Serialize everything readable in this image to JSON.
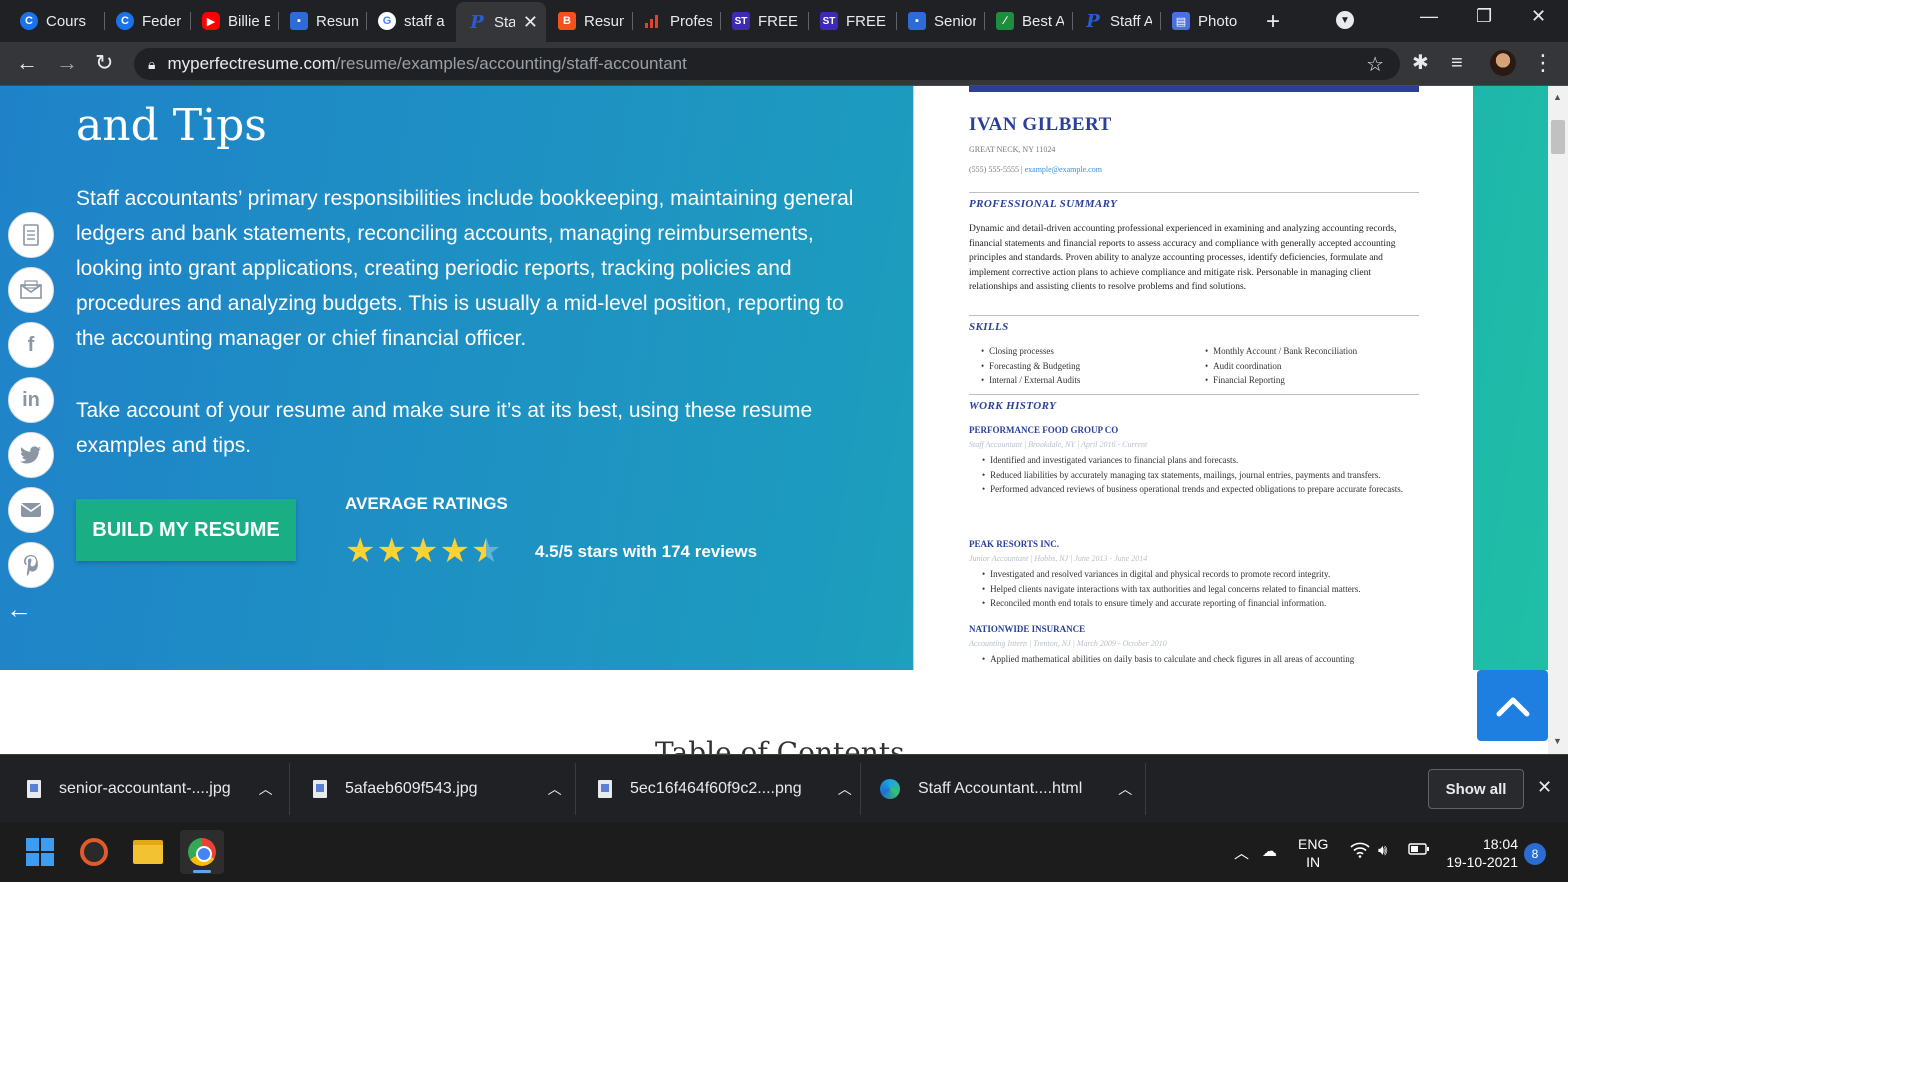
{
  "browser": {
    "tabs": [
      {
        "title": "Cours",
        "favicon": "c-blue-icon",
        "active": false
      },
      {
        "title": "Feder",
        "favicon": "c-blue-icon",
        "active": false
      },
      {
        "title": "Billie E",
        "favicon": "youtube-icon",
        "active": false
      },
      {
        "title": "Resum",
        "favicon": "document-icon",
        "active": false
      },
      {
        "title": "staff a",
        "favicon": "google-icon",
        "active": false
      },
      {
        "title": "Sta",
        "favicon": "p-logo-icon",
        "active": true
      },
      {
        "title": "Resum",
        "favicon": "blogger-icon",
        "active": false
      },
      {
        "title": "Profes",
        "favicon": "bars-icon",
        "active": false
      },
      {
        "title": "FREE",
        "favicon": "st-icon",
        "active": false
      },
      {
        "title": "FREE",
        "favicon": "st-icon",
        "active": false
      },
      {
        "title": "Senior",
        "favicon": "document-icon",
        "active": false
      },
      {
        "title": "Best A",
        "favicon": "chart-icon",
        "active": false
      },
      {
        "title": "Staff A",
        "favicon": "p-logo-icon",
        "active": false
      },
      {
        "title": "Photo",
        "favicon": "doc-blue-icon",
        "active": false
      }
    ],
    "url_host": "myperfectresume.com",
    "url_path": "/resume/examples/accounting/staff-accountant"
  },
  "hero": {
    "title": "and Tips",
    "paragraph_1": "Staff accountants’ primary responsibilities include bookkeeping, maintaining general ledgers and bank statements, reconciling accounts, managing reimbursements, looking into grant applications, creating periodic reports, tracking policies and procedures and analyzing budgets. This is usually a mid-level position, reporting to the accounting manager or chief financial officer.",
    "paragraph_2": "Take account of your resume and make sure it’s at its best, using these resume examples and tips.",
    "cta_label": "BUILD MY RESUME",
    "ratings_heading": "AVERAGE RATINGS",
    "rating_value": 4.5,
    "rating_text": "4.5/5 stars with 174 reviews"
  },
  "share_icons": [
    "resume-icon",
    "mail-envelope-icon",
    "facebook-icon",
    "linkedin-icon",
    "twitter-icon",
    "email-icon",
    "pinterest-icon"
  ],
  "resume": {
    "name": "IVAN GILBERT",
    "location": "GREAT NECK, NY 11024",
    "phone": "(555) 555-5555 | ",
    "email": "example@example.com",
    "summary_heading": "PROFESSIONAL SUMMARY",
    "summary": "Dynamic and detail-driven accounting professional experienced in examining and analyzing accounting records, financial statements and financial reports to assess accuracy and compliance with generally accepted accounting principles and standards. Proven ability to analyze accounting processes, identify deficiencies, formulate and implement corrective action plans to achieve compliance and mitigate risk. Personable in managing client relationships and assisting clients to resolve problems and find solutions.",
    "skills_heading": "SKILLS",
    "skills_left": [
      "Closing processes",
      "Forecasting & Budgeting",
      "Internal / External Audits"
    ],
    "skills_right": [
      "Monthly Account / Bank Reconciliation",
      "Audit coordination",
      "Financial Reporting"
    ],
    "work_heading": "WORK HISTORY",
    "jobs": [
      {
        "company": "PERFORMANCE FOOD GROUP CO",
        "meta": "Staff Accountant | Brookdale, NY | April 2016 - Current",
        "bullets": [
          "Identified and investigated variances to financial plans and forecasts.",
          "Reduced liabilities by accurately managing tax statements, mailings, journal entries, payments and transfers.",
          "Performed advanced reviews of business operational trends and expected obligations to prepare accurate forecasts."
        ]
      },
      {
        "company": "PEAK RESORTS INC.",
        "meta": "Junior Accountant | Hobbs, NJ | June 2013 - June 2014",
        "bullets": [
          "Investigated and resolved variances in digital and physical records to promote record integrity.",
          "Helped clients navigate interactions with tax authorities and legal concerns related to financial matters.",
          "Reconciled month end totals to ensure timely and accurate reporting of financial information."
        ]
      },
      {
        "company": "NATIONWIDE INSURANCE",
        "meta": "Accounting Intern | Trenton, NJ | March 2009 - October 2010",
        "bullets": [
          "Applied mathematical abilities on daily basis to calculate and check figures in all areas of accounting"
        ]
      }
    ]
  },
  "toc_heading": "Table of Contents",
  "downloads": {
    "items": [
      {
        "name": "senior-accountant-....jpg",
        "icon": "image-file-icon"
      },
      {
        "name": "5afaeb609f543.jpg",
        "icon": "image-file-icon"
      },
      {
        "name": "5ec16f464f60f9c2....png",
        "icon": "image-file-icon"
      },
      {
        "name": "Staff Accountant....html",
        "icon": "edge-icon"
      }
    ],
    "show_all_label": "Show all"
  },
  "taskbar": {
    "lang_line1": "ENG",
    "lang_line2": "IN",
    "time": "18:04",
    "date": "19-10-2021",
    "notification_count": "8"
  },
  "colors": {
    "hero_start": "#1f82c9",
    "hero_end": "#1fbfa5",
    "cta": "#1aae84",
    "resume_accent": "#2a3f9a",
    "star": "#ffd230",
    "scroll_top": "#1f7fe0"
  }
}
